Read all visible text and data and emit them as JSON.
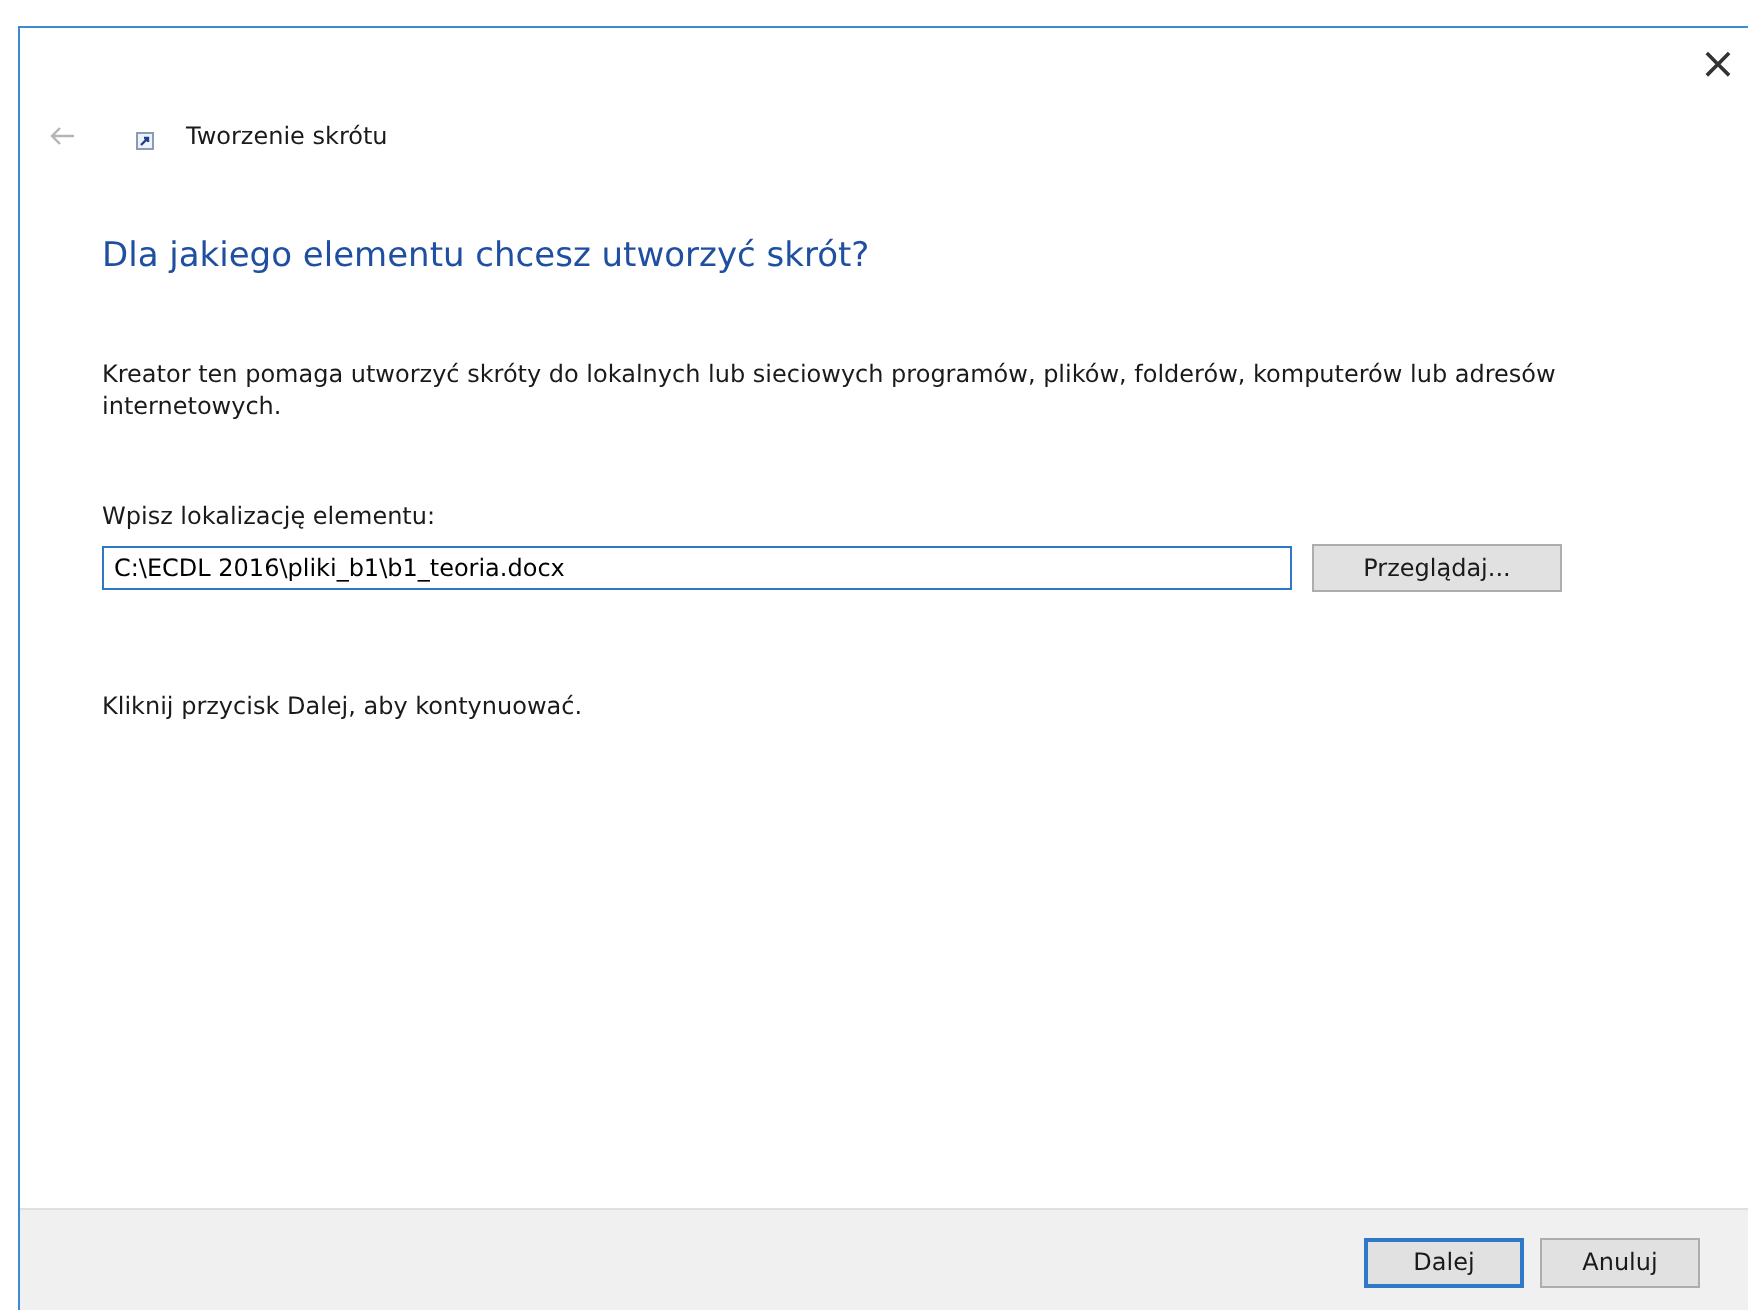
{
  "window": {
    "title": "Tworzenie skrótu",
    "close": "×"
  },
  "heading": "Dla jakiego elementu chcesz utworzyć skrót?",
  "description": "Kreator ten pomaga utworzyć skróty do lokalnych lub sieciowych programów, plików, folderów, komputerów lub adresów internetowych.",
  "location": {
    "label": "Wpisz lokalizację elementu:",
    "value": "C:\\ECDL 2016\\pliki_b1\\b1_teoria.docx",
    "browse_button": "Przeglądaj..."
  },
  "hint": "Kliknij przycisk Dalej, aby kontynuować.",
  "buttons": [
    {
      "label": "Dalej",
      "default": true
    },
    {
      "label": "Anuluj",
      "default": false
    }
  ]
}
